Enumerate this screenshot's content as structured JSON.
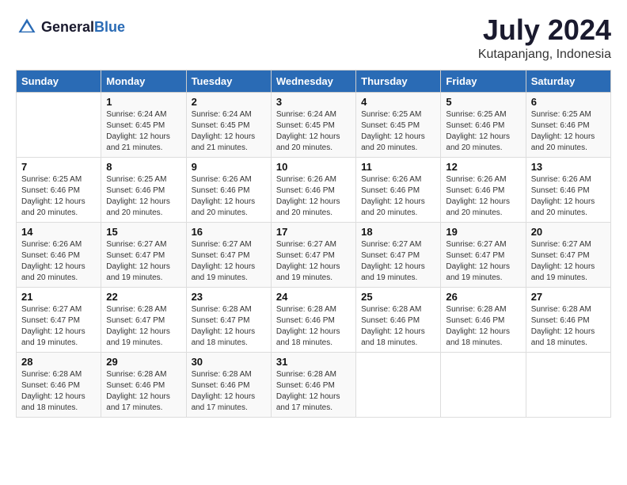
{
  "header": {
    "logo_general": "General",
    "logo_blue": "Blue",
    "month_year": "July 2024",
    "location": "Kutapanjang, Indonesia"
  },
  "days_of_week": [
    "Sunday",
    "Monday",
    "Tuesday",
    "Wednesday",
    "Thursday",
    "Friday",
    "Saturday"
  ],
  "weeks": [
    [
      {
        "day": "",
        "sunrise": "",
        "sunset": "",
        "daylight": "",
        "empty": true
      },
      {
        "day": "1",
        "sunrise": "Sunrise: 6:24 AM",
        "sunset": "Sunset: 6:45 PM",
        "daylight": "Daylight: 12 hours and 21 minutes."
      },
      {
        "day": "2",
        "sunrise": "Sunrise: 6:24 AM",
        "sunset": "Sunset: 6:45 PM",
        "daylight": "Daylight: 12 hours and 21 minutes."
      },
      {
        "day": "3",
        "sunrise": "Sunrise: 6:24 AM",
        "sunset": "Sunset: 6:45 PM",
        "daylight": "Daylight: 12 hours and 20 minutes."
      },
      {
        "day": "4",
        "sunrise": "Sunrise: 6:25 AM",
        "sunset": "Sunset: 6:45 PM",
        "daylight": "Daylight: 12 hours and 20 minutes."
      },
      {
        "day": "5",
        "sunrise": "Sunrise: 6:25 AM",
        "sunset": "Sunset: 6:46 PM",
        "daylight": "Daylight: 12 hours and 20 minutes."
      },
      {
        "day": "6",
        "sunrise": "Sunrise: 6:25 AM",
        "sunset": "Sunset: 6:46 PM",
        "daylight": "Daylight: 12 hours and 20 minutes."
      }
    ],
    [
      {
        "day": "7",
        "sunrise": "Sunrise: 6:25 AM",
        "sunset": "Sunset: 6:46 PM",
        "daylight": "Daylight: 12 hours and 20 minutes."
      },
      {
        "day": "8",
        "sunrise": "Sunrise: 6:25 AM",
        "sunset": "Sunset: 6:46 PM",
        "daylight": "Daylight: 12 hours and 20 minutes."
      },
      {
        "day": "9",
        "sunrise": "Sunrise: 6:26 AM",
        "sunset": "Sunset: 6:46 PM",
        "daylight": "Daylight: 12 hours and 20 minutes."
      },
      {
        "day": "10",
        "sunrise": "Sunrise: 6:26 AM",
        "sunset": "Sunset: 6:46 PM",
        "daylight": "Daylight: 12 hours and 20 minutes."
      },
      {
        "day": "11",
        "sunrise": "Sunrise: 6:26 AM",
        "sunset": "Sunset: 6:46 PM",
        "daylight": "Daylight: 12 hours and 20 minutes."
      },
      {
        "day": "12",
        "sunrise": "Sunrise: 6:26 AM",
        "sunset": "Sunset: 6:46 PM",
        "daylight": "Daylight: 12 hours and 20 minutes."
      },
      {
        "day": "13",
        "sunrise": "Sunrise: 6:26 AM",
        "sunset": "Sunset: 6:46 PM",
        "daylight": "Daylight: 12 hours and 20 minutes."
      }
    ],
    [
      {
        "day": "14",
        "sunrise": "Sunrise: 6:26 AM",
        "sunset": "Sunset: 6:46 PM",
        "daylight": "Daylight: 12 hours and 20 minutes."
      },
      {
        "day": "15",
        "sunrise": "Sunrise: 6:27 AM",
        "sunset": "Sunset: 6:47 PM",
        "daylight": "Daylight: 12 hours and 19 minutes."
      },
      {
        "day": "16",
        "sunrise": "Sunrise: 6:27 AM",
        "sunset": "Sunset: 6:47 PM",
        "daylight": "Daylight: 12 hours and 19 minutes."
      },
      {
        "day": "17",
        "sunrise": "Sunrise: 6:27 AM",
        "sunset": "Sunset: 6:47 PM",
        "daylight": "Daylight: 12 hours and 19 minutes."
      },
      {
        "day": "18",
        "sunrise": "Sunrise: 6:27 AM",
        "sunset": "Sunset: 6:47 PM",
        "daylight": "Daylight: 12 hours and 19 minutes."
      },
      {
        "day": "19",
        "sunrise": "Sunrise: 6:27 AM",
        "sunset": "Sunset: 6:47 PM",
        "daylight": "Daylight: 12 hours and 19 minutes."
      },
      {
        "day": "20",
        "sunrise": "Sunrise: 6:27 AM",
        "sunset": "Sunset: 6:47 PM",
        "daylight": "Daylight: 12 hours and 19 minutes."
      }
    ],
    [
      {
        "day": "21",
        "sunrise": "Sunrise: 6:27 AM",
        "sunset": "Sunset: 6:47 PM",
        "daylight": "Daylight: 12 hours and 19 minutes."
      },
      {
        "day": "22",
        "sunrise": "Sunrise: 6:28 AM",
        "sunset": "Sunset: 6:47 PM",
        "daylight": "Daylight: 12 hours and 19 minutes."
      },
      {
        "day": "23",
        "sunrise": "Sunrise: 6:28 AM",
        "sunset": "Sunset: 6:47 PM",
        "daylight": "Daylight: 12 hours and 18 minutes."
      },
      {
        "day": "24",
        "sunrise": "Sunrise: 6:28 AM",
        "sunset": "Sunset: 6:46 PM",
        "daylight": "Daylight: 12 hours and 18 minutes."
      },
      {
        "day": "25",
        "sunrise": "Sunrise: 6:28 AM",
        "sunset": "Sunset: 6:46 PM",
        "daylight": "Daylight: 12 hours and 18 minutes."
      },
      {
        "day": "26",
        "sunrise": "Sunrise: 6:28 AM",
        "sunset": "Sunset: 6:46 PM",
        "daylight": "Daylight: 12 hours and 18 minutes."
      },
      {
        "day": "27",
        "sunrise": "Sunrise: 6:28 AM",
        "sunset": "Sunset: 6:46 PM",
        "daylight": "Daylight: 12 hours and 18 minutes."
      }
    ],
    [
      {
        "day": "28",
        "sunrise": "Sunrise: 6:28 AM",
        "sunset": "Sunset: 6:46 PM",
        "daylight": "Daylight: 12 hours and 18 minutes."
      },
      {
        "day": "29",
        "sunrise": "Sunrise: 6:28 AM",
        "sunset": "Sunset: 6:46 PM",
        "daylight": "Daylight: 12 hours and 17 minutes."
      },
      {
        "day": "30",
        "sunrise": "Sunrise: 6:28 AM",
        "sunset": "Sunset: 6:46 PM",
        "daylight": "Daylight: 12 hours and 17 minutes."
      },
      {
        "day": "31",
        "sunrise": "Sunrise: 6:28 AM",
        "sunset": "Sunset: 6:46 PM",
        "daylight": "Daylight: 12 hours and 17 minutes."
      },
      {
        "day": "",
        "sunrise": "",
        "sunset": "",
        "daylight": "",
        "empty": true
      },
      {
        "day": "",
        "sunrise": "",
        "sunset": "",
        "daylight": "",
        "empty": true
      },
      {
        "day": "",
        "sunrise": "",
        "sunset": "",
        "daylight": "",
        "empty": true
      }
    ]
  ]
}
